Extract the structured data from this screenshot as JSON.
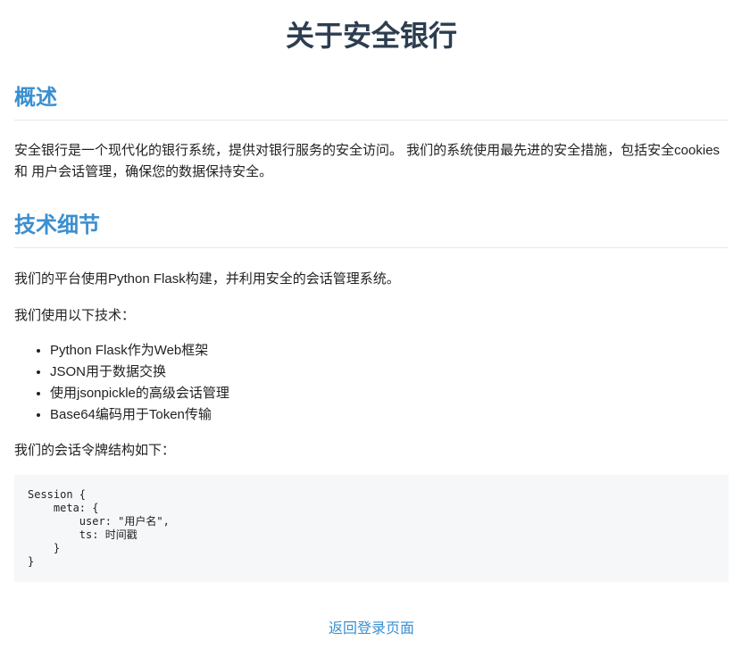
{
  "page": {
    "title": "关于安全银行"
  },
  "overview": {
    "heading": "概述",
    "body": "安全银行是一个现代化的银行系统，提供对银行服务的安全访问。 我们的系统使用最先进的安全措施，包括安全cookies和 用户会话管理，确保您的数据保持安全。"
  },
  "technical": {
    "heading": "技术细节",
    "intro": "我们的平台使用Python Flask构建，并利用安全的会话管理系统。",
    "list_intro": "我们使用以下技术：",
    "items": [
      "Python Flask作为Web框架",
      "JSON用于数据交换",
      "使用jsonpickle的高级会话管理",
      "Base64编码用于Token传输"
    ],
    "structure_intro": "我们的会话令牌结构如下：",
    "code": "Session {\n    meta: {\n        user: \"用户名\",\n        ts: 时间戳\n    }\n}"
  },
  "footer": {
    "back_link": "返回登录页面"
  },
  "colors": {
    "title": "#2c3e50",
    "accent": "#3a8fd0",
    "code_bg": "#f6f7f9",
    "divider": "#e5e8eb"
  }
}
